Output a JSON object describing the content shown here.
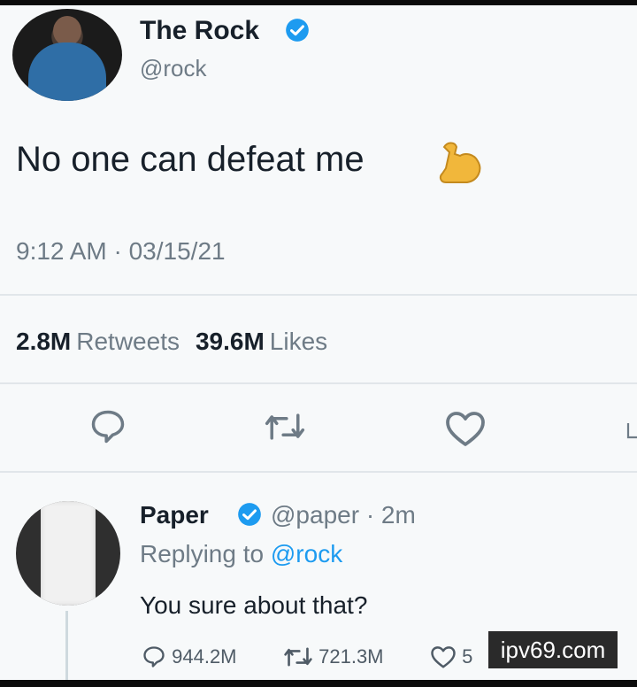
{
  "tweet": {
    "author_name": "The Rock",
    "author_handle": "@rock",
    "text": "No one can defeat me",
    "emoji": "flexed-biceps",
    "timestamp": "9:12 AM · 03/15/21",
    "retweet_count": "2.8M",
    "retweet_label": "Retweets",
    "like_count": "39.6M",
    "like_label": "Likes"
  },
  "reply": {
    "author_name": "Paper",
    "author_handle": "@paper",
    "time": "· 2m",
    "replying_prefix": "Replying to",
    "replying_handle": "@rock",
    "text": "You sure about that?",
    "reply_count": "944.2M",
    "retweet_count": "721.3M",
    "like_count_partial": "5"
  },
  "watermark": "ipv69.com",
  "colors": {
    "background": "#f7f9fa",
    "text": "#17202a",
    "muted": "#6e7b86",
    "link": "#1d9bf0",
    "verified": "#1d9bf0"
  },
  "icons": [
    "verified-badge-icon",
    "flexed-biceps-emoji",
    "reply-icon",
    "retweet-icon",
    "like-icon",
    "share-icon"
  ]
}
